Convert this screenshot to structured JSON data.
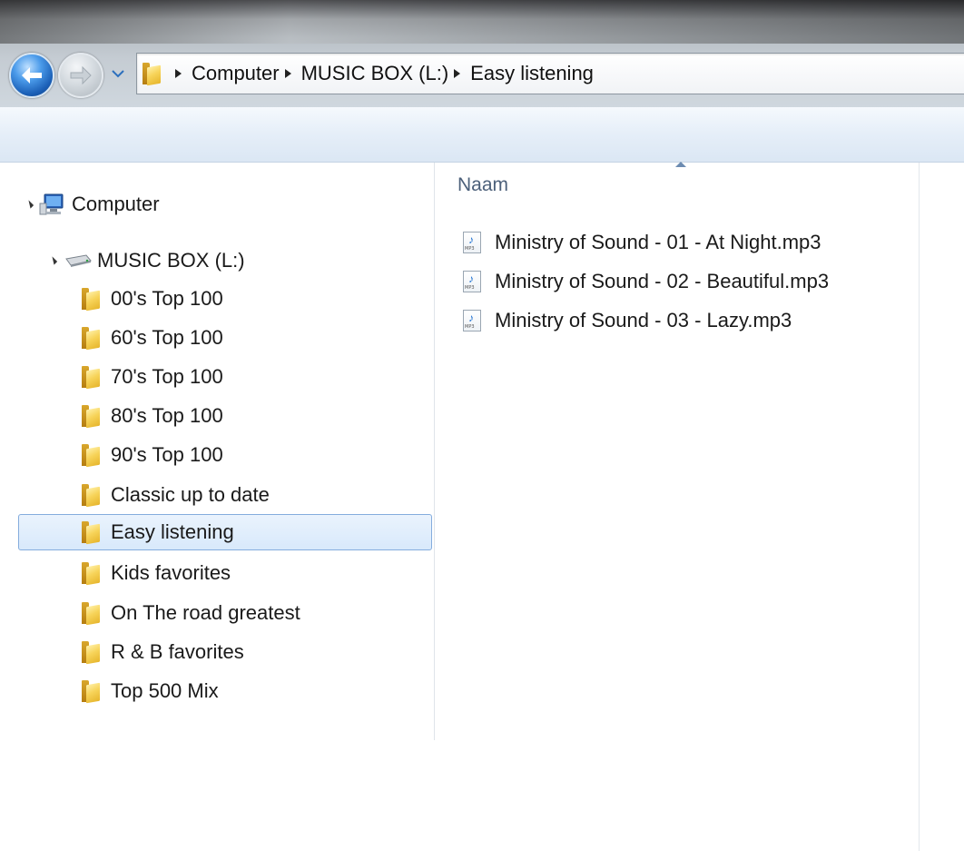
{
  "address_bar": {
    "breadcrumbs": [
      "Computer",
      "MUSIC BOX (L:)",
      "Easy listening"
    ]
  },
  "navigation": {
    "computer_label": "Computer",
    "drive_label": "MUSIC BOX (L:)",
    "folders": [
      "00's  Top 100",
      "60's  Top 100",
      "70's  Top 100",
      "80's  Top 100",
      "90's  Top 100",
      "Classic up to date",
      "Easy listening",
      "Kids favorites",
      "On The road greatest",
      "R & B  favorites",
      "Top 500 Mix"
    ],
    "selected_folder": "Easy listening"
  },
  "content": {
    "column_header": "Naam",
    "files": [
      "Ministry of Sound - 01 - At Night.mp3",
      "Ministry of Sound - 02 - Beautiful.mp3",
      "Ministry of Sound - 03 - Lazy.mp3"
    ]
  },
  "colors": {
    "selection_border": "#84acdd",
    "folder_yellow": "#f7d45a",
    "header_text": "#4c607a"
  }
}
